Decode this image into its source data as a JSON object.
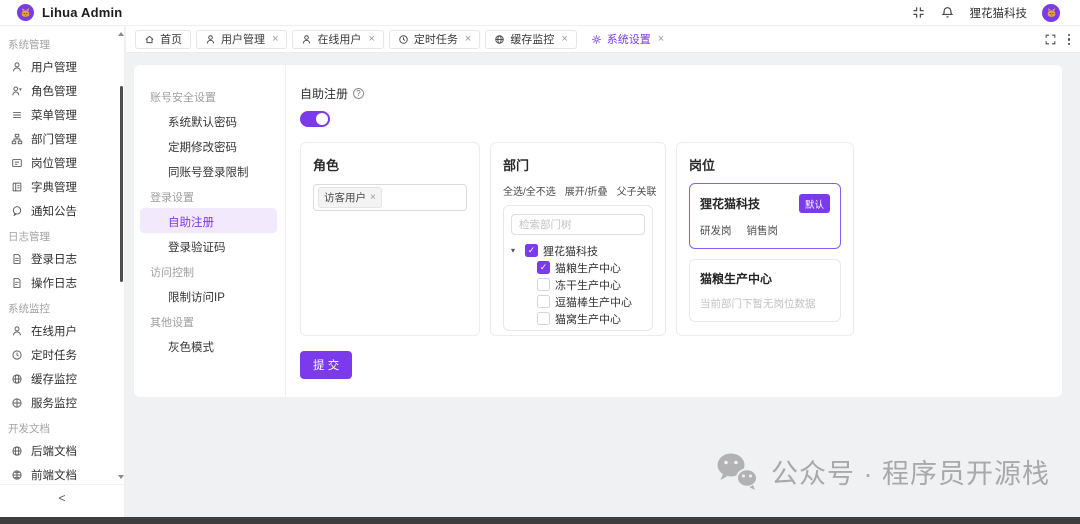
{
  "brand": {
    "name": "Lihua Admin"
  },
  "header": {
    "company": "狸花猫科技"
  },
  "glyphs": {
    "close": "×",
    "check": "✓",
    "caret_down": "▾",
    "collapse": "<",
    "question": "?"
  },
  "tabs": [
    {
      "label": "首页"
    },
    {
      "label": "用户管理"
    },
    {
      "label": "在线用户"
    },
    {
      "label": "定时任务"
    },
    {
      "label": "缓存监控"
    },
    {
      "label": "系统设置"
    }
  ],
  "sidebar": {
    "groups": [
      {
        "label": "系统管理",
        "items": [
          {
            "label": "用户管理"
          },
          {
            "label": "角色管理"
          },
          {
            "label": "菜单管理"
          },
          {
            "label": "部门管理"
          },
          {
            "label": "岗位管理"
          },
          {
            "label": "字典管理"
          },
          {
            "label": "通知公告"
          }
        ]
      },
      {
        "label": "日志管理",
        "items": [
          {
            "label": "登录日志"
          },
          {
            "label": "操作日志"
          }
        ]
      },
      {
        "label": "系统监控",
        "items": [
          {
            "label": "在线用户"
          },
          {
            "label": "定时任务"
          },
          {
            "label": "缓存监控"
          },
          {
            "label": "服务监控"
          }
        ]
      },
      {
        "label": "开发文档",
        "items": [
          {
            "label": "后端文档"
          },
          {
            "label": "前端文档"
          }
        ]
      }
    ]
  },
  "settings_menu": {
    "sections": [
      {
        "label": "账号安全设置",
        "items": [
          "系统默认密码",
          "定期修改密码",
          "同账号登录限制"
        ]
      },
      {
        "label": "登录设置",
        "items": [
          "自助注册",
          "登录验证码"
        ]
      },
      {
        "label": "访问控制",
        "items": [
          "限制访问IP"
        ]
      },
      {
        "label": "其他设置",
        "items": [
          "灰色模式"
        ]
      }
    ],
    "active_item": "自助注册"
  },
  "panel": {
    "title": "自助注册",
    "toggle_on": true,
    "role_card": {
      "title": "角色",
      "tags": [
        {
          "label": "访客用户"
        }
      ]
    },
    "dept_card": {
      "title": "部门",
      "actions": [
        "全选/全不选",
        "展开/折叠",
        "父子关联"
      ],
      "search_placeholder": "检索部门树",
      "tree": [
        {
          "label": "狸花猫科技",
          "checked": true,
          "root": true
        },
        {
          "label": "猫粮生产中心",
          "checked": true
        },
        {
          "label": "冻干生产中心",
          "checked": false
        },
        {
          "label": "逗猫棒生产中心",
          "checked": false
        },
        {
          "label": "猫窝生产中心",
          "checked": false
        }
      ]
    },
    "post_card": {
      "title": "岗位",
      "groups": [
        {
          "name": "狸花猫科技",
          "badge": "默认",
          "posts": [
            "研发岗",
            "销售岗"
          ],
          "selected": true
        },
        {
          "name": "猫粮生产中心",
          "empty_text": "当前部门下暂无岗位数据",
          "selected": false
        }
      ]
    },
    "submit_label": "提 交"
  },
  "watermark": {
    "text": "公众号 · 程序员开源栈"
  },
  "colors": {
    "primary": "#7c3aed",
    "active_bg": "#f3e9fd",
    "page_bg": "#f0f1f2"
  }
}
